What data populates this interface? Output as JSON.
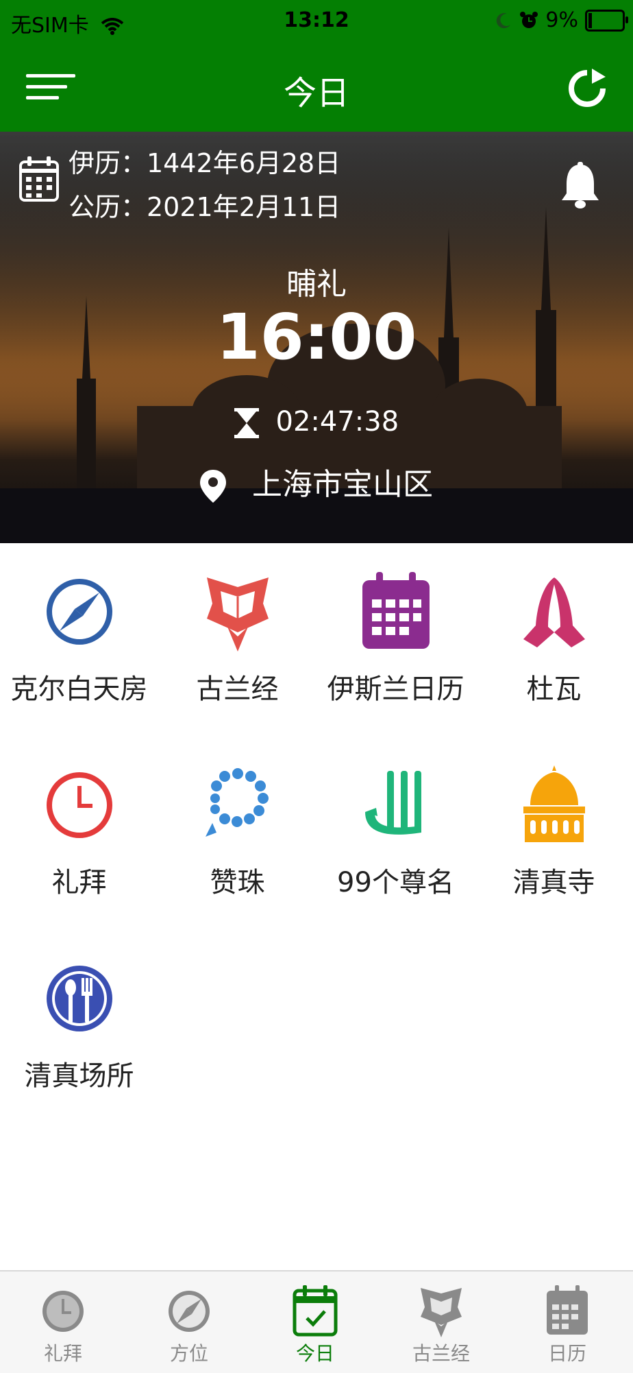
{
  "status_bar": {
    "carrier": "无SIM卡",
    "time": "13:12",
    "battery_percent": "9%",
    "battery_level": 0.09
  },
  "nav": {
    "title": "今日",
    "menu_icon": "menu-icon",
    "refresh_icon": "refresh-icon"
  },
  "hero": {
    "hijri_date": "伊历：1442年6月28日",
    "gregorian_date": "公历：2021年2月11日",
    "prayer_name": "晡礼",
    "prayer_time": "16:00",
    "countdown": "02:47:38",
    "location": "上海市宝山区"
  },
  "features": [
    {
      "label": "克尔白天房",
      "icon": "compass-icon",
      "color": "#2f5fa8"
    },
    {
      "label": "古兰经",
      "icon": "quran-icon",
      "color": "#e2514a"
    },
    {
      "label": "伊斯兰日历",
      "icon": "calendar-icon",
      "color": "#8b2c8f"
    },
    {
      "label": "杜瓦",
      "icon": "praying-hands-icon",
      "color": "#c9336b"
    },
    {
      "label": "礼拜",
      "icon": "clock-icon",
      "color": "#e43b3b"
    },
    {
      "label": "赞珠",
      "icon": "prayer-beads-icon",
      "color": "#3b8bd6"
    },
    {
      "label": "99个尊名",
      "icon": "allah-calligraphy-icon",
      "color": "#1fb57a"
    },
    {
      "label": "清真寺",
      "icon": "mosque-icon",
      "color": "#f6a40b"
    },
    {
      "label": "清真场所",
      "icon": "restaurant-icon",
      "color": "#3a4fb2"
    }
  ],
  "tabs": [
    {
      "label": "礼拜",
      "icon": "clock-icon",
      "active": false
    },
    {
      "label": "方位",
      "icon": "compass-icon",
      "active": false
    },
    {
      "label": "今日",
      "icon": "today-calendar-icon",
      "active": true
    },
    {
      "label": "古兰经",
      "icon": "quran-icon",
      "active": false
    },
    {
      "label": "日历",
      "icon": "calendar-icon",
      "active": false
    }
  ],
  "colors": {
    "brand_green": "#047f03",
    "active_tab": "#0b7d0a",
    "inactive_tab": "#8a8a8a"
  }
}
